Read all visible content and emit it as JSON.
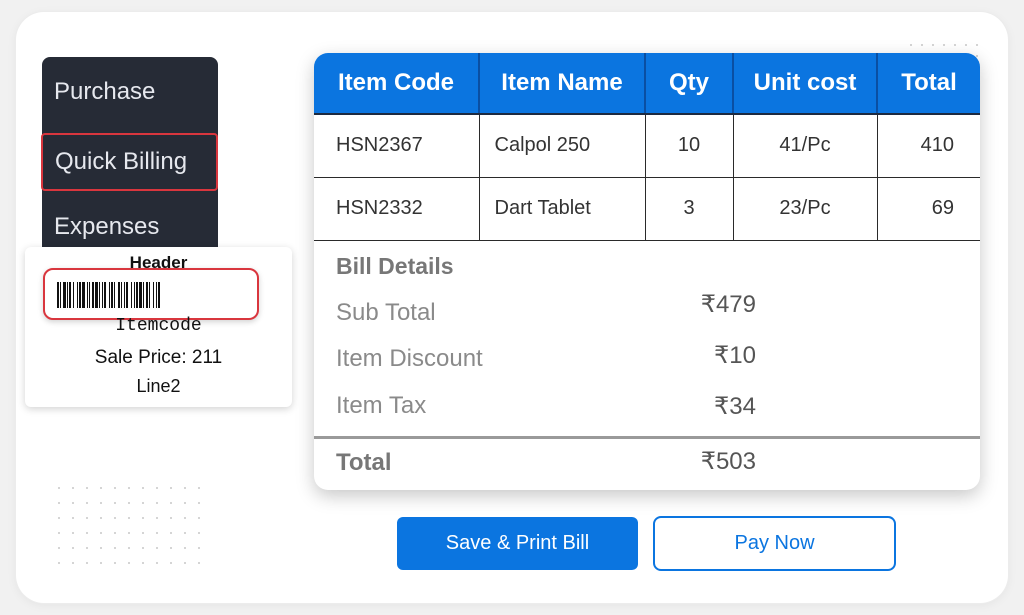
{
  "sidebar": {
    "items": [
      {
        "label": "Purchase"
      },
      {
        "label": "Quick Billing"
      },
      {
        "label": "Expenses"
      }
    ]
  },
  "barcode_label": {
    "header": "Header",
    "itemcode": "Itemcode",
    "sale_price": "Sale Price: 211",
    "line2": "Line2"
  },
  "bill": {
    "columns": [
      "Item Code",
      "Item Name",
      "Qty",
      "Unit cost",
      "Total"
    ],
    "rows": [
      {
        "code": "HSN2367",
        "name": "Calpol 250",
        "qty": "10",
        "unit_cost": "41/Pc",
        "total": "410"
      },
      {
        "code": "HSN2332",
        "name": "Dart Tablet",
        "qty": "3",
        "unit_cost": "23/Pc",
        "total": "69"
      }
    ],
    "details_title": "Bill Details",
    "sub_total_label": "Sub Total",
    "sub_total_value": "₹479",
    "discount_label": "Item Discount",
    "discount_value": "₹10",
    "tax_label": "Item Tax",
    "tax_value": "₹34",
    "total_label": "Total",
    "total_value": "₹503"
  },
  "actions": {
    "save_print": "Save & Print Bill",
    "pay_now": "Pay Now"
  },
  "colors": {
    "accent": "#0b75e0",
    "sidebar_bg": "#262b36",
    "highlight": "#d9363e"
  }
}
